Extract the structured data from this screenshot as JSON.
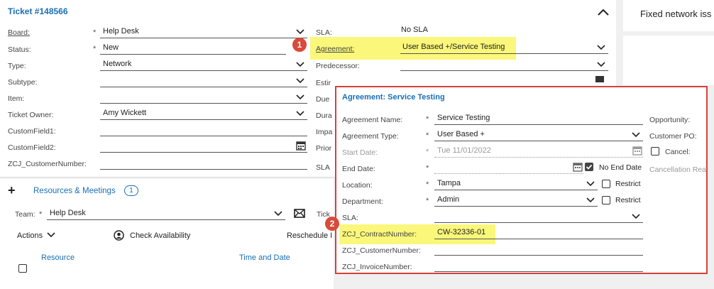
{
  "ticket": {
    "title": "Ticket #148566",
    "fields": [
      {
        "label": "Board:",
        "value": "Help Desk"
      },
      {
        "label": "Status:",
        "value": "New"
      },
      {
        "label": "Type:",
        "value": "Network"
      },
      {
        "label": "Subtype:",
        "value": ""
      },
      {
        "label": "Item:",
        "value": ""
      },
      {
        "label": "Ticket Owner:",
        "value": "Amy Wickett"
      },
      {
        "label": "CustomField1:",
        "value": ""
      },
      {
        "label": "CustomField2:",
        "value": ""
      },
      {
        "label": "ZCJ_CustomerNumber:",
        "value": ""
      }
    ],
    "required_mark": "*",
    "right_labels": [
      "SLA:",
      "Agreement:",
      "Predecessor:",
      "Estir",
      "Due",
      "Dura",
      "Impa",
      "Prior",
      "SLA"
    ],
    "sla_value": "No SLA",
    "agreement_value": "User Based +/Service Testing"
  },
  "right_panel": {
    "text": "Fixed network iss"
  },
  "badges": {
    "one": "1",
    "two": "2"
  },
  "resources": {
    "plus": "+",
    "title": "Resources & Meetings",
    "count": "1",
    "team_label": "Team:",
    "team_value": "Help Desk",
    "tick_label": "Tick",
    "actions_label": "Actions",
    "check_availability": "Check Availability",
    "reschedule": "Reschedule I",
    "col_resource": "Resource",
    "col_time": "Time and Date"
  },
  "agreement_popup": {
    "title": "Agreement: Service Testing",
    "left_fields": [
      {
        "label": "Agreement Name:",
        "value": "Service Testing"
      },
      {
        "label": "Agreement Type:",
        "value": "User Based +"
      },
      {
        "label": "Start Date:",
        "value": "Tue 11/01/2022"
      },
      {
        "label": "End Date:",
        "value": ""
      },
      {
        "label": "Location:",
        "value": "Tampa"
      },
      {
        "label": "Department:",
        "value": "Admin"
      },
      {
        "label": "SLA:",
        "value": ""
      },
      {
        "label": "ZCJ_ContractNumber:",
        "value": "CW-32336-01"
      },
      {
        "label": "ZCJ_CustomerNumber:",
        "value": ""
      },
      {
        "label": "ZCJ_InvoiceNumber:",
        "value": ""
      }
    ],
    "no_end_date": "No End Date",
    "restrict": "Restrict",
    "right_labels": {
      "opportunity": "Opportunity:",
      "customer_po": "Customer PO:",
      "cancel": "Cancel:",
      "cancellation": "Cancellation Rea"
    }
  }
}
